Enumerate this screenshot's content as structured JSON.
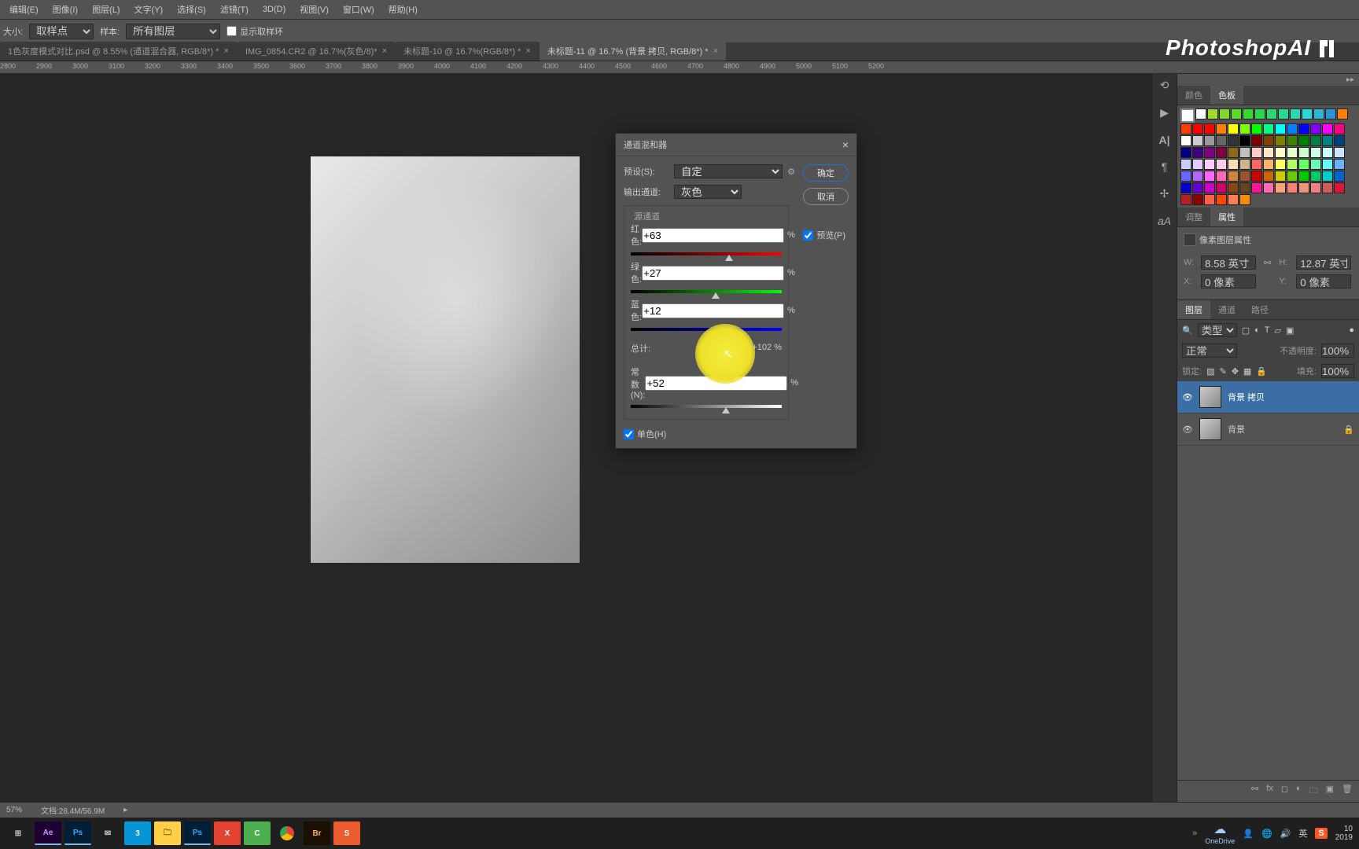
{
  "menu": [
    "编辑(E)",
    "图像(I)",
    "图层(L)",
    "文字(Y)",
    "选择(S)",
    "滤镜(T)",
    "3D(D)",
    "视图(V)",
    "窗口(W)",
    "帮助(H)"
  ],
  "options": {
    "size_label": "大小:",
    "size_value": "取样点",
    "sample_label": "样本:",
    "sample_value": "所有图层",
    "show_ring": "显示取样环"
  },
  "tabs": [
    {
      "label": "1色灰度模式对比.psd @ 8.55% (通道混合器, RGB/8*) *",
      "active": false
    },
    {
      "label": "IMG_0854.CR2 @ 16.7%(灰色/8)*",
      "active": false
    },
    {
      "label": "未标题-10 @ 16.7%(RGB/8*) *",
      "active": false
    },
    {
      "label": "未标题-11 @ 16.7% (背景 拷贝, RGB/8*) *",
      "active": true
    }
  ],
  "ruler_ticks": [
    2800,
    2900,
    3000,
    3100,
    3200,
    3300,
    3400,
    3500,
    3600,
    3700,
    3800,
    3900,
    4000,
    4100,
    4200,
    4300,
    4400,
    4500,
    4600,
    4700,
    4800,
    4900,
    5000,
    5100,
    5200
  ],
  "dialog": {
    "title": "通道混和器",
    "preset_label": "预设(S):",
    "preset_value": "自定",
    "output_label": "输出通道:",
    "output_value": "灰色",
    "ok": "确定",
    "cancel": "取消",
    "preview": "预览(P)",
    "source_title": "源通道",
    "red_label": "红色:",
    "red_value": "+63",
    "green_label": "绿色:",
    "green_value": "+27",
    "blue_label": "蓝色:",
    "blue_value": "+12",
    "total_label": "总计:",
    "total_value": "+102",
    "constant_label": "常数(N):",
    "constant_value": "+52",
    "mono": "单色(H)",
    "percent": "%"
  },
  "panels": {
    "color_tab": "颜色",
    "swatches_tab": "色板",
    "adjust_tab": "调整",
    "props_tab": "属性",
    "props_header": "像素图层属性",
    "w_label": "W:",
    "w_value": "8.58 英寸",
    "h_label": "H:",
    "h_value": "12.87 英寸",
    "x_label": "X:",
    "x_value": "0 像素",
    "y_label": "Y:",
    "y_value": "0 像素",
    "layers_tab": "图层",
    "channels_tab": "通道",
    "paths_tab": "路径",
    "kind_label": "类型",
    "blend_mode": "正常",
    "opacity_label": "不透明度:",
    "opacity_value": "100%",
    "lock_label": "锁定:",
    "fill_label": "填充:",
    "fill_value": "100%",
    "layer1": "背景 拷贝",
    "layer2": "背景"
  },
  "swatch_colors": [
    "#ffffff",
    "#a2d82a",
    "#7fd82a",
    "#5cd82a",
    "#39d82a",
    "#2ad84d",
    "#2ad870",
    "#2ad893",
    "#2ad8b6",
    "#2ad8d8",
    "#2ab6d8",
    "#2a93d8",
    "#ff8000",
    "#ff4000",
    "#ff0000",
    "#ff0000",
    "#ff8000",
    "#ffff00",
    "#80ff00",
    "#00ff00",
    "#00ff80",
    "#00ffff",
    "#0080ff",
    "#0000ff",
    "#8000ff",
    "#ff00ff",
    "#ff0080",
    "#ffffff",
    "#cccccc",
    "#999999",
    "#666666",
    "#333333",
    "#000000",
    "#800000",
    "#804000",
    "#808000",
    "#408000",
    "#008000",
    "#008040",
    "#008080",
    "#004080",
    "#000080",
    "#400080",
    "#800080",
    "#800040",
    "#8b6914",
    "#c0c0c0",
    "#ffcccc",
    "#ffe5cc",
    "#ffffcc",
    "#e5ffcc",
    "#ccffcc",
    "#ccffe5",
    "#ccffff",
    "#cce5ff",
    "#ccccff",
    "#e5ccff",
    "#ffccff",
    "#ffcce5",
    "#f5deb3",
    "#d2b48c",
    "#ff6666",
    "#ffb366",
    "#ffff66",
    "#b3ff66",
    "#66ff66",
    "#66ffb3",
    "#66ffff",
    "#66b3ff",
    "#6666ff",
    "#b366ff",
    "#ff66ff",
    "#ff66b3",
    "#cd853f",
    "#a0522d",
    "#cc0000",
    "#cc6600",
    "#cccc00",
    "#66cc00",
    "#00cc00",
    "#00cc66",
    "#00cccc",
    "#0066cc",
    "#0000cc",
    "#6600cc",
    "#cc00cc",
    "#cc0066",
    "#8b4513",
    "#654321",
    "#ff1493",
    "#ff69b4",
    "#ffa07a",
    "#fa8072",
    "#e9967a",
    "#f08080",
    "#cd5c5c",
    "#dc143c",
    "#b22222",
    "#8b0000",
    "#ff6347",
    "#ff4500",
    "#ff7f50",
    "#ff8c00"
  ],
  "status": {
    "zoom": "57%",
    "docsize": "文档:28.4M/56.9M"
  },
  "tray": {
    "onedrive": "OneDrive",
    "ime": "英",
    "sogou": "S",
    "time": "10",
    "date": "2019"
  },
  "watermark": "PhotoshopAI"
}
